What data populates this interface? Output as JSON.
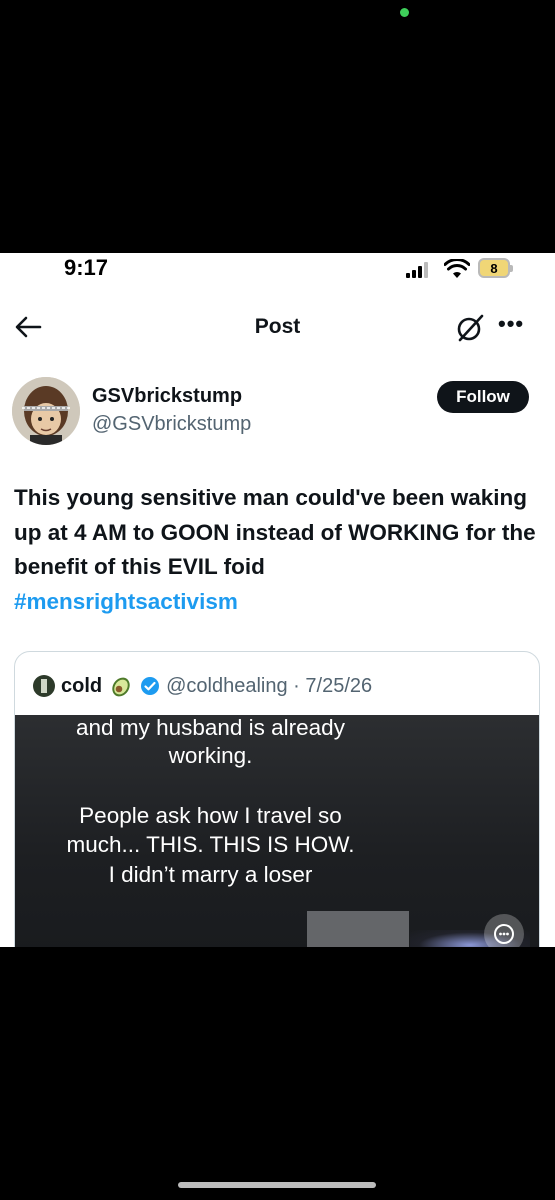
{
  "status_bar": {
    "time": "9:17",
    "battery_level": "8"
  },
  "nav": {
    "title": "Post",
    "more_label": "•••"
  },
  "post": {
    "author": {
      "display_name": "GSVbrickstump",
      "handle": "@GSVbrickstump"
    },
    "follow_label": "Follow",
    "text": "This young sensitive man could've been waking up at 4 AM to GOON instead of WORKING for the benefit of this EVIL foid",
    "hashtag": "#mensrightsactivism"
  },
  "quoted_post": {
    "display_name": "cold",
    "emoji": "avocado",
    "verified": true,
    "handle_date": "@coldhealing · 7/25/26",
    "media_caption_lines": [
      "and my husband is already",
      "working.",
      "People ask how I travel so",
      "much... THIS. THIS IS HOW.",
      "I didn’t marry a loser"
    ]
  },
  "colors": {
    "link": "#1d9bf0",
    "text_primary": "#0f1419",
    "text_secondary": "#536471",
    "follow_bg": "#0f1419",
    "verified": "#1d9bf0"
  }
}
